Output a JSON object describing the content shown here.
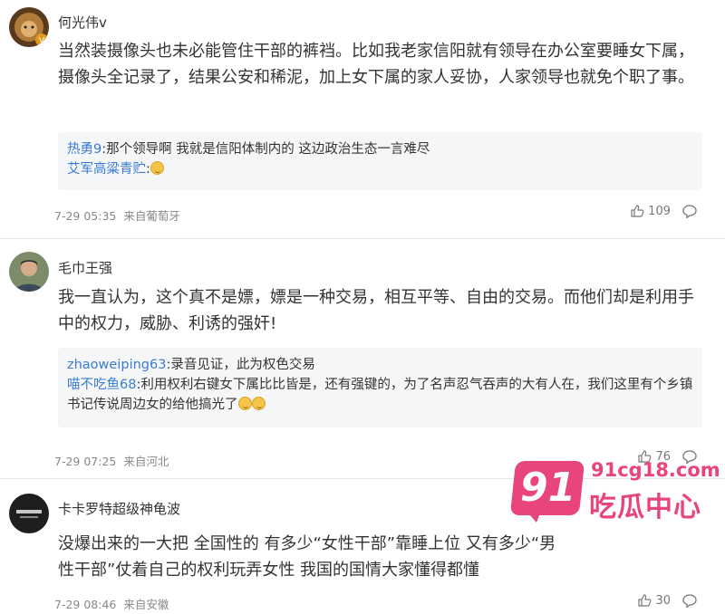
{
  "comments": [
    {
      "author": "何光伟v",
      "avatar": "avatar-lion-badge",
      "text": "当然装摄像头也未必能管住干部的裤裆。比如我老家信阳就有领导在办公室要睡女下属，摄像头全记录了，结果公安和稀泥，加上女下属的家人妥协，人家领导也就免个职了事。",
      "replies": [
        {
          "user": "热勇9",
          "text": ":那个领导啊 我就是信阳体制内的 这边政治生态一言难尽"
        },
        {
          "user": "艾军高粱青贮",
          "text": ":"
        }
      ],
      "time": "7-29 05:35",
      "source": "来自葡萄牙",
      "likes": "109"
    },
    {
      "author": "毛巾王强",
      "avatar": "avatar-man",
      "text": "我一直认为，这个真不是嫖，嫖是一种交易，相互平等、自由的交易。而他们却是利用手中的权力，威胁、利诱的强奸!",
      "replies": [
        {
          "user": "zhaoweiping63",
          "text": ":录音见证，此为权色交易"
        },
        {
          "user": "喵不吃鱼68",
          "text": ":利用权利右键女下属比比皆是，还有强键的，为了名声忍气吞声的大有人在，我们这里有个乡镇书记传说周边女的给他搞光了"
        }
      ],
      "time": "7-29 07:25",
      "source": "来自河北",
      "likes": "76"
    },
    {
      "author": "卡卡罗特超级神龟波",
      "avatar": "avatar-dark-logo",
      "text": "没爆出来的一大把 全国性的 有多少“女性干部”靠睡上位 又有多少“男性干部”仗着自己的权利玩弄女性 我国的国情大家懂得都懂",
      "replies": [],
      "time": "7-29 08:46",
      "source": "来自安徽",
      "likes": "30"
    }
  ],
  "watermark": {
    "badge": "91",
    "site": "91cg18.com",
    "name": "吃瓜中心"
  },
  "colors": {
    "reply_user": "#3a7bd5",
    "watermark": "#e8457a"
  }
}
